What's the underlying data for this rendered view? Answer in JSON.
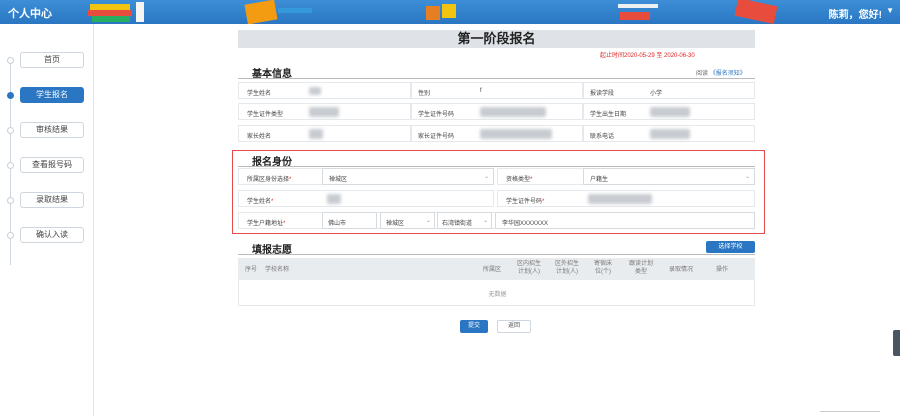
{
  "header": {
    "title": "个人中心",
    "user_greeting": "陈莉，您好!",
    "caret": "▼"
  },
  "sidebar": {
    "items": [
      {
        "label": "首页",
        "active": false
      },
      {
        "label": "学生报名",
        "active": true
      },
      {
        "label": "审核结果",
        "active": false
      },
      {
        "label": "查看报号码",
        "active": false
      },
      {
        "label": "录取结果",
        "active": false
      },
      {
        "label": "确认入读",
        "active": false
      }
    ]
  },
  "main": {
    "title": "第一阶段报名",
    "deadline": "起止时间2020-05-29 至 2020-06-30",
    "basic_info": {
      "heading": "基本信息",
      "read_prefix": "阅读",
      "read_link": "《报名须知》",
      "fields": {
        "student_name": "学生姓名",
        "gender": "性别",
        "gender_value": "f",
        "school_stage": "报读学段",
        "school_stage_value": "小学",
        "id_type": "学生证件类型",
        "id_number": "学生证件号码",
        "birth_date": "学生出生日期",
        "parent_name": "家长姓名",
        "parent_id": "家长证件号码",
        "phone": "联系电话"
      }
    },
    "identity": {
      "heading": "报名身份",
      "district_label": "所属区身份选择",
      "district_value": "禅城区",
      "qualification_label": "资格类型",
      "qualification_value": "户籍生",
      "student_name_label": "学生姓名",
      "student_id_label": "学生证件号码",
      "household_label": "学生户籍地址",
      "city_value": "佛山市",
      "area_value": "禅城区",
      "street_value": "石湾镇街道",
      "address_value": "李华园XXXXXXX"
    },
    "preference": {
      "heading": "填报志愿",
      "select_button": "选择学校",
      "columns": {
        "seq": "序号",
        "school_name": "学校名称",
        "district": "所属区",
        "in_district_plan": "区内招生计划(人)",
        "out_district_plan": "区外招生计划(人)",
        "boarding": "寄宿床位(个)",
        "plan_type": "跟读计划类型",
        "admission": "录取情况",
        "operation": "操作"
      },
      "empty_text": "无数据"
    },
    "buttons": {
      "submit": "提交",
      "back": "返回"
    }
  },
  "colors": {
    "brand_blue": "#2a76c3",
    "required_red": "#e02020",
    "highlight_border": "#e64b4b"
  }
}
